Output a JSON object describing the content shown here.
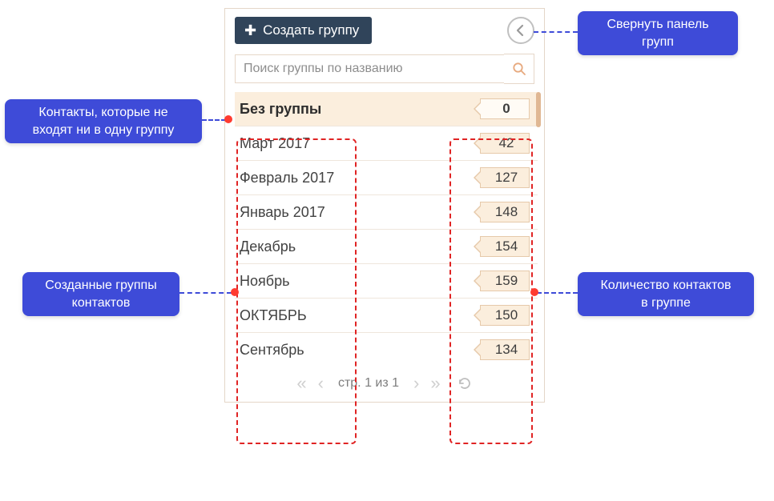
{
  "panel": {
    "create_label": "Создать группу",
    "search_placeholder": "Поиск группы по названию",
    "ungrouped": {
      "name": "Без группы",
      "count": "0"
    },
    "groups": [
      {
        "name": "Март 2017",
        "count": "42"
      },
      {
        "name": "Февраль 2017",
        "count": "127"
      },
      {
        "name": "Январь 2017",
        "count": "148"
      },
      {
        "name": "Декабрь",
        "count": "154"
      },
      {
        "name": "Ноябрь",
        "count": "159"
      },
      {
        "name": "ОКТЯБРЬ",
        "count": "150"
      },
      {
        "name": "Сентябрь",
        "count": "134"
      }
    ],
    "pager_label": "стр. 1 из 1"
  },
  "callouts": {
    "collapse": "Свернуть панель\nгрупп",
    "ungrouped": "Контакты, которые не\nвходят ни в одну группу",
    "created": "Созданные группы\nконтактов",
    "count": "Количество контактов\nв группе"
  }
}
